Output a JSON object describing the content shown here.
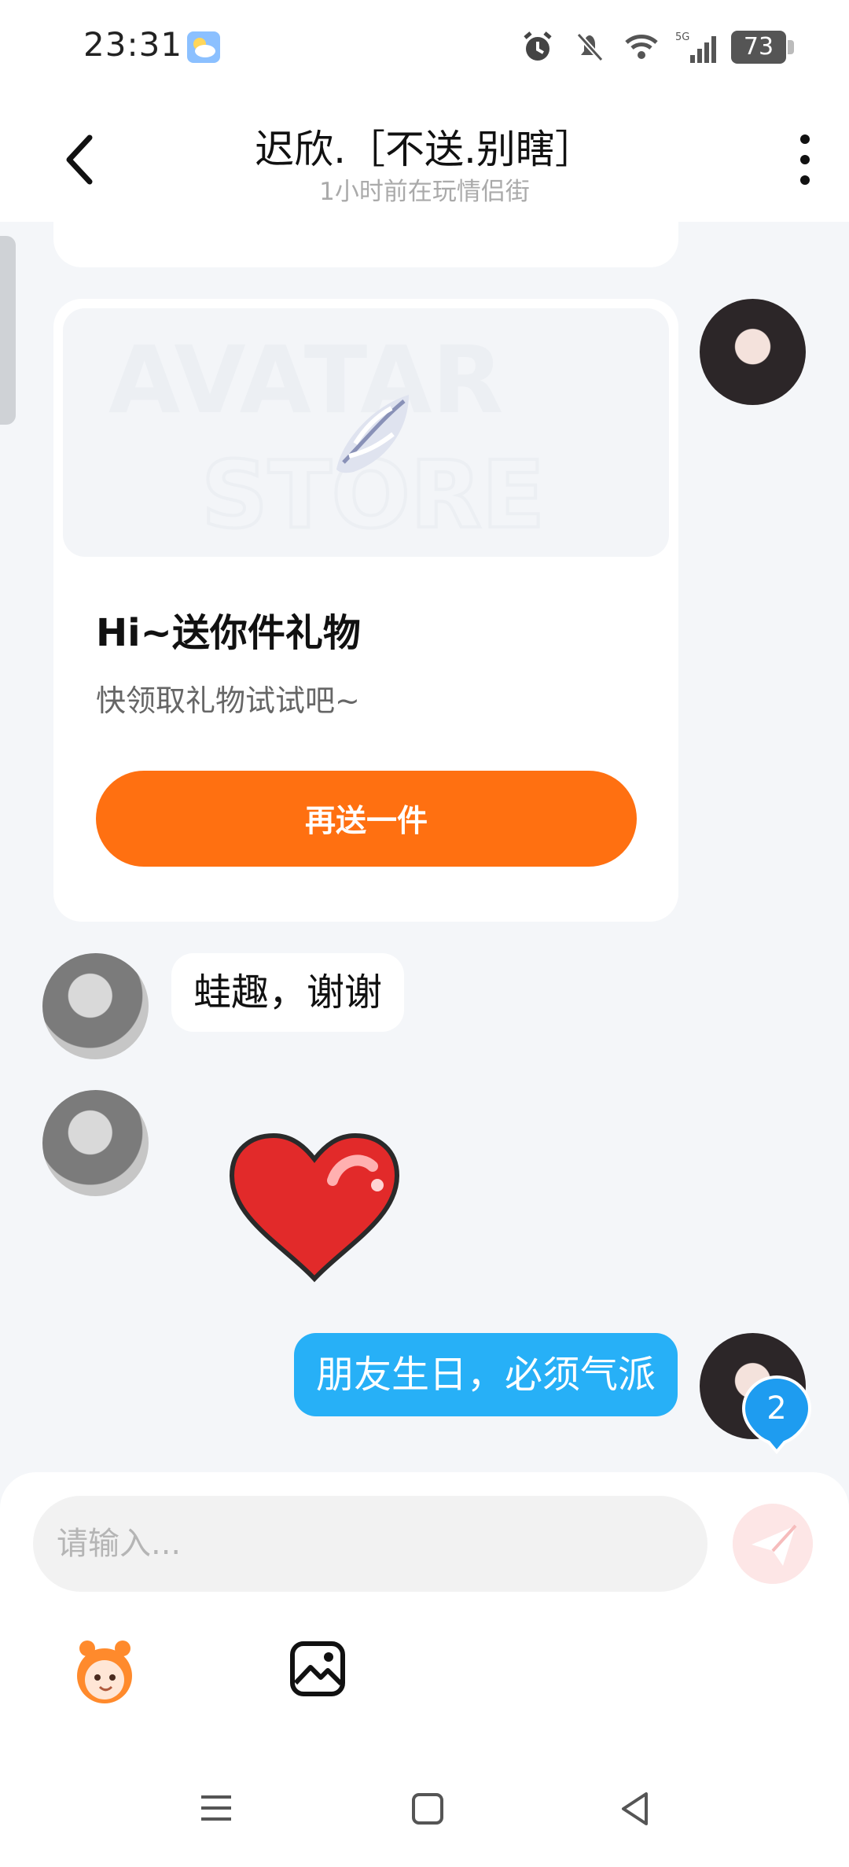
{
  "status_bar": {
    "time": "23:31",
    "network": "5G",
    "battery": "73",
    "icons": [
      "weather-icon",
      "alarm-icon",
      "mute-icon",
      "wifi-icon",
      "signal-icon",
      "battery-icon"
    ]
  },
  "header": {
    "title": "迟欣.［不送.别瞎］",
    "subtitle": "1小时前在玩情侣街",
    "back_icon": "chevron-left-icon",
    "more_icon": "more-vertical-icon"
  },
  "gift_card": {
    "banner_text": "AVATAR STORE",
    "title": "Hi~送你件礼物",
    "description": "快领取礼物试试吧~",
    "button_label": "再送一件"
  },
  "messages": [
    {
      "sender": "other",
      "type": "text",
      "text": "蛙趣，谢谢"
    },
    {
      "sender": "other",
      "type": "sticker",
      "sticker": "heart-sticker"
    },
    {
      "sender": "me",
      "type": "text",
      "text": "朋友生日，必须气派"
    }
  ],
  "unread_badge": "2",
  "composer": {
    "placeholder": "请输入...",
    "send_icon": "send-icon",
    "tools": [
      "mascot-icon",
      "image-icon"
    ]
  },
  "navigation": [
    "menu-icon",
    "home-icon",
    "back-icon"
  ],
  "colors": {
    "accent_orange": "#ff7011",
    "my_bubble_blue": "#27b0f7",
    "page_background": "#f4f6f9"
  }
}
